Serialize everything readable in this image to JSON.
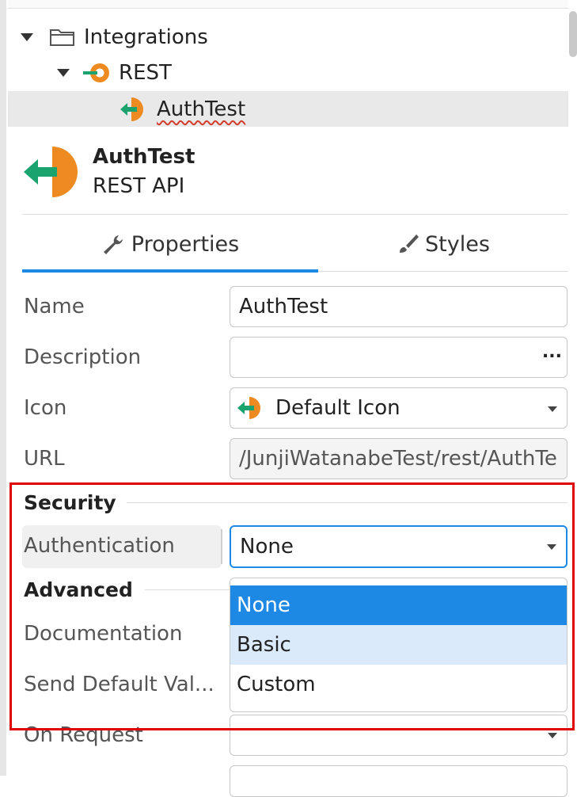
{
  "tree": {
    "integrations_label": "Integrations",
    "rest_label": "REST",
    "authtest_label": "AuthTest"
  },
  "header": {
    "title": "AuthTest",
    "subtitle": "REST API"
  },
  "tabs": {
    "properties": "Properties",
    "styles": "Styles"
  },
  "props": {
    "name_label": "Name",
    "name_value": "AuthTest",
    "description_label": "Description",
    "description_value": "",
    "description_more": "...",
    "icon_label": "Icon",
    "icon_value": "Default Icon",
    "url_label": "URL",
    "url_value": "/JunjiWatanabeTest/rest/AuthTe"
  },
  "security": {
    "title": "Security",
    "auth_label": "Authentication",
    "auth_value": "None"
  },
  "advanced": {
    "title": "Advanced",
    "documentation_label": "Documentation",
    "send_default_label": "Send Default Val...",
    "on_request_label": "On Request"
  },
  "dropdown": {
    "options": [
      "None",
      "Basic",
      "Custom"
    ]
  },
  "colors": {
    "accent": "#1e88e5",
    "icon_orange": "#ee8a22",
    "icon_green": "#1aa36f",
    "highlight_box": "#e00000"
  }
}
